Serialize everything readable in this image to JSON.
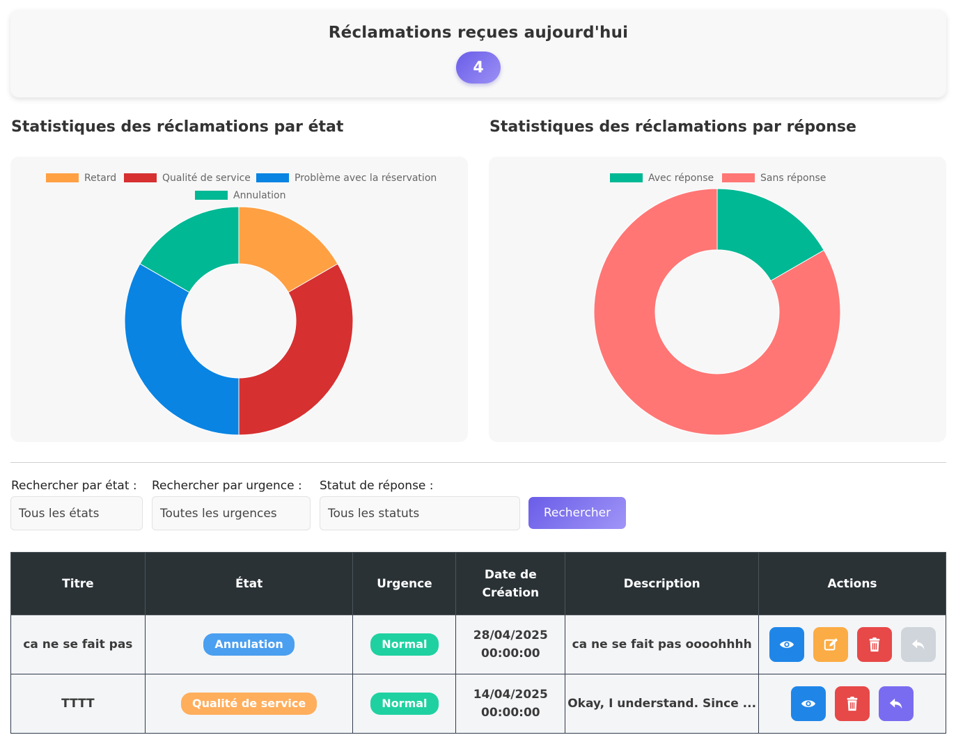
{
  "header": {
    "title": "Réclamations reçues aujourd'hui",
    "count": "4"
  },
  "charts": {
    "state_title": "Statistiques des réclamations par état",
    "response_title": "Statistiques des réclamations par réponse"
  },
  "chart_data": [
    {
      "type": "pie",
      "variant": "doughnut",
      "categories": [
        "Retard",
        "Qualité de service",
        "Problème avec la réservation",
        "Annulation"
      ],
      "values": [
        1,
        2,
        2,
        1
      ],
      "colors": [
        "#ffa043",
        "#d63031",
        "#0984e3",
        "#00b894"
      ],
      "legend": "top"
    },
    {
      "type": "pie",
      "variant": "doughnut",
      "categories": [
        "Avec réponse",
        "Sans réponse"
      ],
      "values": [
        1,
        5
      ],
      "colors": [
        "#00b894",
        "#ff7675"
      ],
      "legend": "top"
    }
  ],
  "filters": {
    "state_label": "Rechercher par état :",
    "state_value": "Tous les états",
    "urgency_label": "Rechercher par urgence :",
    "urgency_value": "Toutes les urgences",
    "response_label": "Statut de réponse :",
    "response_value": "Tous les statuts",
    "search_button": "Rechercher"
  },
  "table": {
    "headers": [
      "Titre",
      "État",
      "Urgence",
      "Date de Création",
      "Description",
      "Actions"
    ],
    "rows": [
      {
        "title": "ca ne se fait pas",
        "state": "Annulation",
        "state_color": "#4a9ff0",
        "urgency": "Normal",
        "urgency_color": "#1fd1a0",
        "date": "28/04/2025",
        "time": "00:00:00",
        "description": "ca ne se fait pas oooohhhh",
        "actions": [
          "view",
          "edit",
          "delete",
          "reply-disabled"
        ]
      },
      {
        "title": "TTTT",
        "state": "Qualité de service",
        "state_color": "#ffae5c",
        "urgency": "Normal",
        "urgency_color": "#1fd1a0",
        "date": "14/04/2025",
        "time": "00:00:00",
        "description": "Okay, I understand. Since ...",
        "actions": [
          "view",
          "delete",
          "reply"
        ]
      }
    ]
  },
  "colors": {
    "view": "#1f86e8",
    "edit": "#fbac45",
    "delete": "#e74848",
    "reply": "#7a6cf0",
    "reply_disabled": "#cfd5da"
  }
}
